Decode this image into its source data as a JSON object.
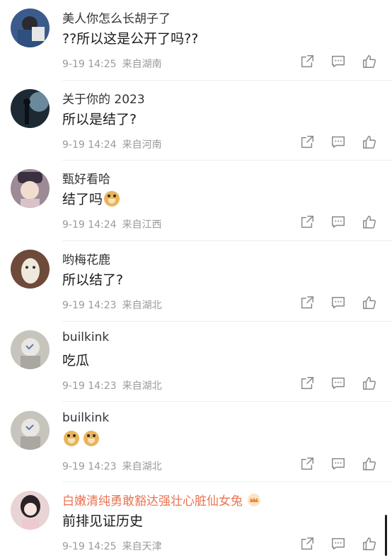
{
  "comments": [
    {
      "username": "美人你怎么长胡子了",
      "text": "??所以这是公开了吗??",
      "time": "9-19 14:25",
      "location": "来自湖南",
      "avatar_color": "#3b5b8c"
    },
    {
      "username": "关于你的 2023",
      "text": "所以是结了?",
      "time": "9-19 14:24",
      "location": "来自河南",
      "avatar_color": "#1e2a33"
    },
    {
      "username": "甄好看哈",
      "text": "结了吗",
      "emoji": [
        "doge"
      ],
      "time": "9-19 14:24",
      "location": "来自江西",
      "avatar_color": "#7b6a7a"
    },
    {
      "username": "哟梅花鹿",
      "text": "所以结了?",
      "time": "9-19 14:23",
      "location": "来自湖北",
      "avatar_color": "#8a5a44"
    },
    {
      "username": "builkink",
      "text": "吃瓜",
      "time": "9-19 14:23",
      "location": "来自湖北",
      "avatar_color": "#c7c4bd"
    },
    {
      "username": "builkink",
      "text": "",
      "emoji": [
        "doge",
        "doge"
      ],
      "time": "9-19 14:23",
      "location": "来自湖北",
      "avatar_color": "#c7c4bd"
    },
    {
      "username": "白嫩清纯勇敢豁达强壮心脏仙女兔",
      "username_color": "#eb7350",
      "badge": "crown-icon",
      "text": "前排见证历史",
      "time": "9-19 14:25",
      "location": "来自天津",
      "avatar_color": "#e8d4d4"
    }
  ],
  "actions": {
    "share": "share-icon",
    "comment": "comment-icon",
    "like": "like-icon"
  },
  "colors": {
    "meta": "#9a9a9a",
    "highlight_name": "#eb7350",
    "icon": "#888888"
  }
}
